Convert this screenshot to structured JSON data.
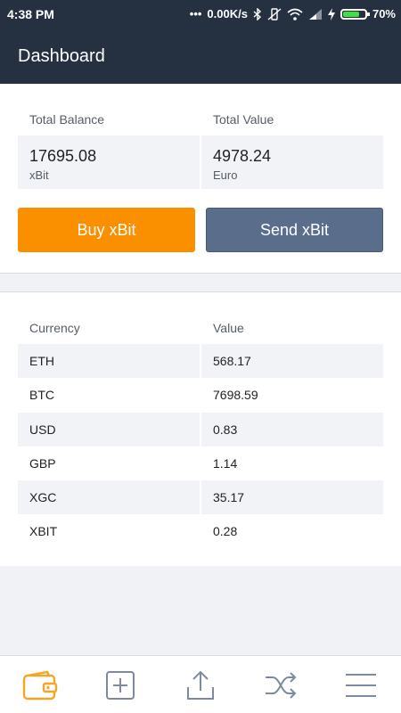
{
  "status_bar": {
    "time": "4:38 PM",
    "network_speed": "0.00K/s",
    "battery": "70%"
  },
  "header": {
    "title": "Dashboard"
  },
  "summary": {
    "total_balance_label": "Total Balance",
    "total_value_label": "Total Value",
    "balance_value": "17695.08",
    "balance_unit": "xBit",
    "value_value": "4978.24",
    "value_unit": "Euro"
  },
  "actions": {
    "buy_label": "Buy xBit",
    "send_label": "Send xBit"
  },
  "rates": {
    "headers": [
      "Currency",
      "Value"
    ],
    "rows": [
      {
        "currency": "ETH",
        "value": "568.17"
      },
      {
        "currency": "BTC",
        "value": "7698.59"
      },
      {
        "currency": "USD",
        "value": "0.83"
      },
      {
        "currency": "GBP",
        "value": "1.14"
      },
      {
        "currency": "XGC",
        "value": "35.17"
      },
      {
        "currency": "XBIT",
        "value": "0.28"
      }
    ]
  },
  "bottom_nav": {
    "items": [
      {
        "icon": "wallet-icon",
        "active": true
      },
      {
        "icon": "add-square-icon",
        "active": false
      },
      {
        "icon": "upload-icon",
        "active": false
      },
      {
        "icon": "shuffle-icon",
        "active": false
      },
      {
        "icon": "menu-icon",
        "active": false
      }
    ]
  },
  "colors": {
    "header_bg": "#253040",
    "buy_button": "#fa8f00",
    "send_button": "#5a6e8c",
    "active_nav": "#f5a623",
    "inactive_nav": "#7d8ba0"
  }
}
